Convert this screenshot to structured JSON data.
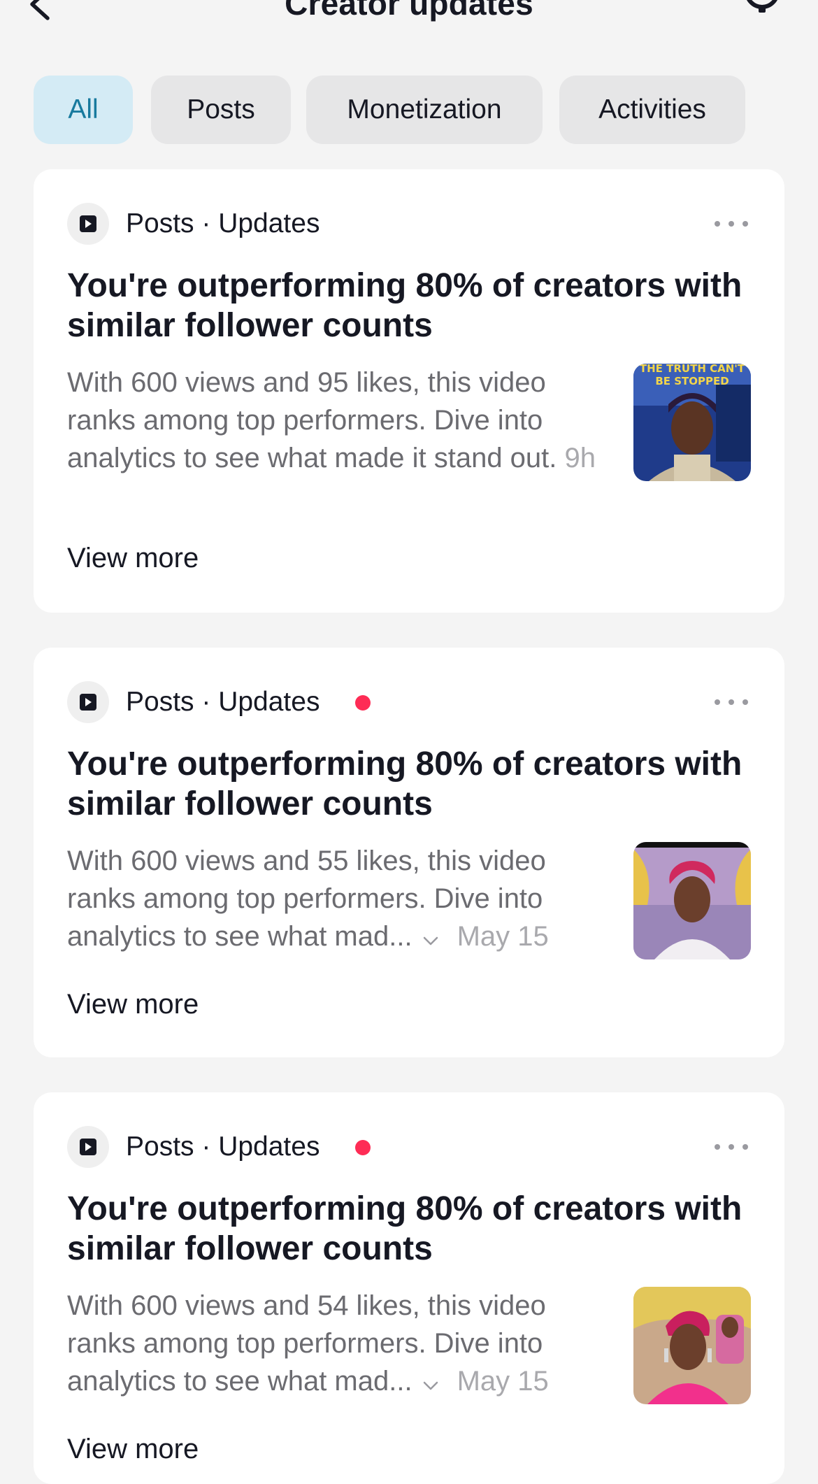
{
  "header": {
    "title": "Creator updates",
    "back_icon": "chevron-left-icon",
    "settings_icon": "gear-icon"
  },
  "tabs": [
    {
      "label": "All",
      "active": true
    },
    {
      "label": "Posts",
      "active": false
    },
    {
      "label": "Monetization",
      "active": false
    },
    {
      "label": "Activities",
      "active": false
    }
  ],
  "colors": {
    "accent_tab_bg": "#d4ebf5",
    "accent_tab_text": "#187a9e",
    "unread_dot": "#fe2c55"
  },
  "cards": [
    {
      "category": "Posts · Updates",
      "unread": false,
      "title": "You're outperforming 80% of creators with similar follower counts",
      "body": "With 600 views and 95 likes, this video ranks among top performers. Dive into analytics to see what made it stand out.",
      "time": "9h",
      "thumb_caption": "THE TRUTH CAN'T BE STOPPED",
      "view_more": "View more"
    },
    {
      "category": "Posts · Updates",
      "unread": true,
      "title": "You're outperforming 80% of creators with similar follower counts",
      "body": "With 600 views and 55 likes, this video ranks among top performers. Dive into analytics to see what mad...",
      "time": "May 15",
      "view_more": "View more"
    },
    {
      "category": "Posts · Updates",
      "unread": true,
      "title": "You're outperforming 80% of creators with similar follower counts",
      "body": "With 600 views and 54 likes, this video ranks among top performers. Dive into analytics to see what mad...",
      "time": "May 15",
      "view_more": "View more"
    }
  ]
}
